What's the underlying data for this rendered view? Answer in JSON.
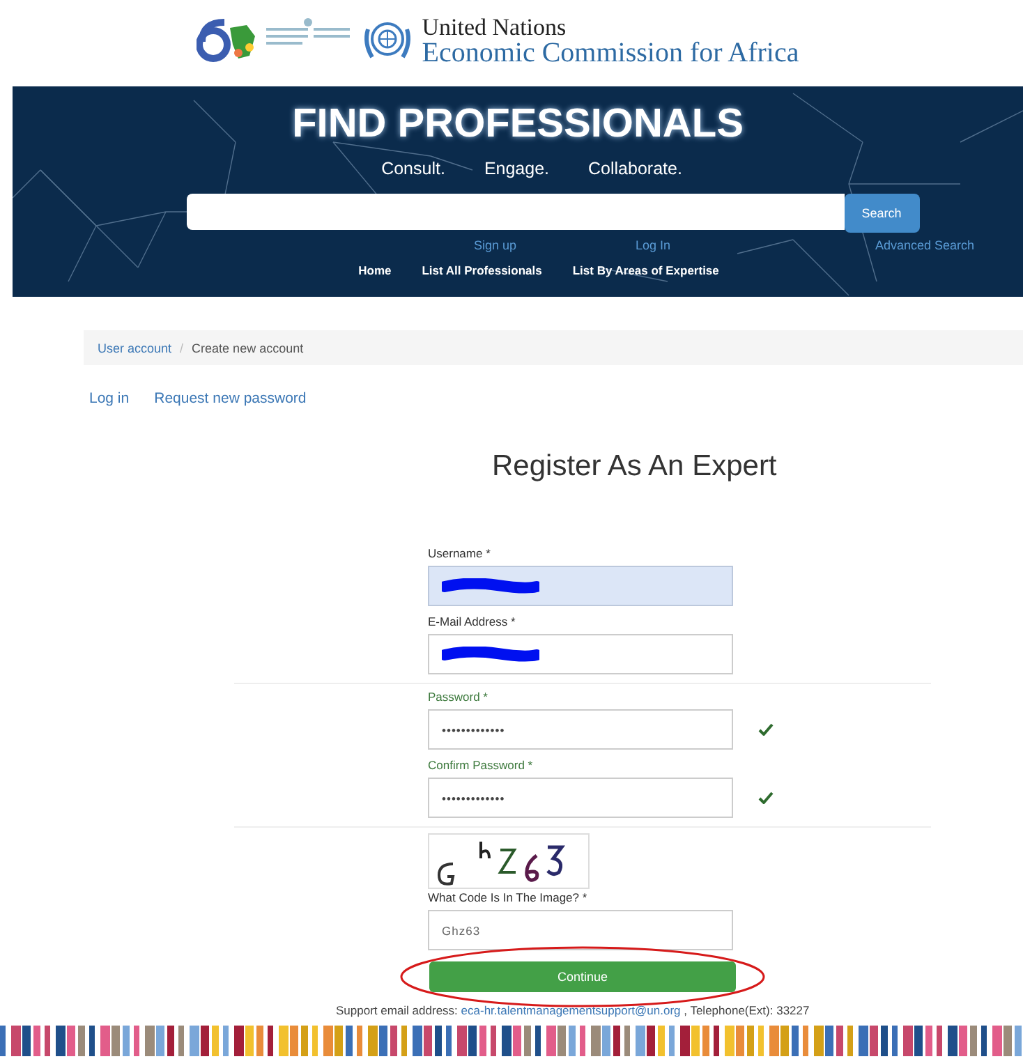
{
  "header": {
    "org_line_1": "United Nations",
    "org_line_2": "Economic Commission for Africa"
  },
  "banner": {
    "title": "FIND PROFESSIONALS",
    "taglines": [
      "Consult.",
      "Engage.",
      "Collaborate."
    ],
    "search": {
      "button": "Search"
    },
    "links": [
      "Sign up",
      "Log In",
      "Advanced Search"
    ],
    "nav": [
      "Home",
      "List All Professionals",
      "List By Areas of Expertise"
    ]
  },
  "breadcrumb": {
    "separator": "/",
    "items": [
      {
        "label": "User account",
        "current": false
      },
      {
        "label": "Create new account",
        "current": true
      }
    ]
  },
  "tabs": [
    "Log in",
    "Request new password"
  ],
  "page_title": "Register As An Expert",
  "form": {
    "groups": [
      [
        {
          "label": "Username *",
          "redacted": true,
          "autofilled": true,
          "valid": false
        },
        {
          "label": "E-Mail Address *",
          "redacted": true,
          "autofilled": false,
          "valid": false
        }
      ],
      [
        {
          "label": "Password *",
          "value": "•••••••••••••",
          "redacted": false,
          "autofilled": false,
          "valid": true
        },
        {
          "label": "Confirm Password *",
          "value": "•••••••••••••",
          "redacted": false,
          "autofilled": false,
          "valid": true
        }
      ]
    ],
    "captcha": {
      "label": "What Code Is In The Image? *",
      "value": "Ghz63"
    },
    "submit": {
      "label": "Continue",
      "annotated": true
    }
  },
  "support": {
    "prefix": "Support email address:",
    "email": "eca-hr.talentmanagementsupport@un.org",
    "suffix": ", Telephone(Ext): 33227"
  }
}
